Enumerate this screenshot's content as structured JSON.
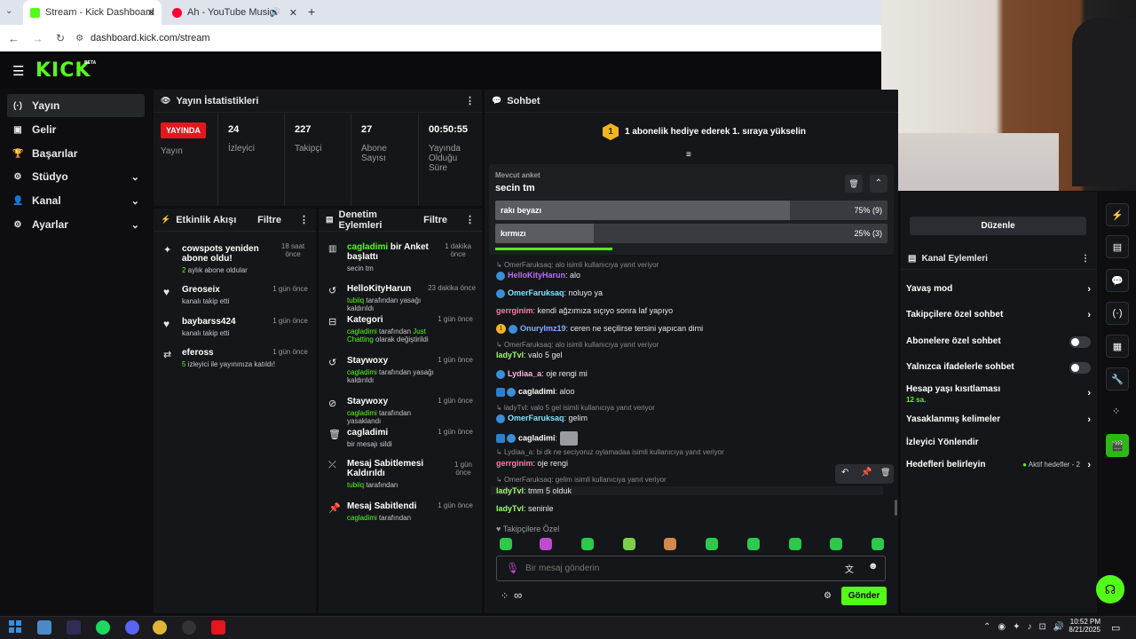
{
  "browser": {
    "tabs": [
      {
        "label": "Stream - Kick Dashboard",
        "active": true
      },
      {
        "label": "Ah - YouTube Music",
        "active": false
      }
    ],
    "new_tab": "+",
    "url": "dashboard.kick.com/stream"
  },
  "header": {
    "logo": "KICK",
    "logo_badge": "BETA"
  },
  "sidebar": {
    "items": [
      {
        "label": "Yayın",
        "icon": "broadcast-icon"
      },
      {
        "label": "Gelir",
        "icon": "dollar-icon"
      },
      {
        "label": "Başarılar",
        "icon": "trophy-icon"
      },
      {
        "label": "Stüdyo",
        "icon": "studio-icon"
      },
      {
        "label": "Kanal",
        "icon": "user-icon"
      },
      {
        "label": "Ayarlar",
        "icon": "gear-icon"
      }
    ]
  },
  "stats": {
    "title": "Yayın İstatistikleri",
    "live_badge": "YAYINDA",
    "live_label": "Yayın",
    "viewers_value": "24",
    "viewers_label": "İzleyici",
    "followers_value": "227",
    "followers_label": "Takipçi",
    "subs_value": "27",
    "subs_label": "Abone Sayısı",
    "uptime_value": "00:50:55",
    "uptime_label": "Yayında Olduğu Süre"
  },
  "activity": {
    "title": "Etkinlik Akışı",
    "filter": "Filtre",
    "items": [
      {
        "title": "cowspots yeniden abone oldu!",
        "sub_green": "2",
        "sub": " aylık abone oldular",
        "time": "18 saat önce"
      },
      {
        "title": "Greoseix",
        "sub_green": "",
        "sub": "kanalı takip etti",
        "time": "1 gün önce"
      },
      {
        "title": "baybarss424",
        "sub_green": "",
        "sub": "kanalı takip etti",
        "time": "1 gün önce"
      },
      {
        "title": "efeross",
        "sub_green": "5",
        "sub": " izleyici ile yayınınıza katıldı!",
        "time": "1 gün önce"
      }
    ]
  },
  "moderation": {
    "title": "Denetim Eylemleri",
    "filter": "Filtre",
    "items": [
      {
        "title_green": "cagladimi",
        "title": " bir Anket başlattı",
        "sub": "secin tm",
        "time": "1 dakika önce"
      },
      {
        "title": "HelloKityHarun",
        "sub_green": "tubiiq",
        "sub": " tarafından yasağı kaldırıldı",
        "time": "23 dakika önce"
      },
      {
        "title": "Kategori",
        "sub_green": "cagladimi",
        "sub": " tarafından ",
        "sub_green2": "Just Chatting",
        "sub2": " olarak değiştirildi",
        "time": "1 gün önce"
      },
      {
        "title": "Staywoxy",
        "sub_green": "cagladimi",
        "sub": " tarafından yasağı kaldırıldı",
        "time": "1 gün önce"
      },
      {
        "title": "Staywoxy",
        "sub_green": "cagladimi",
        "sub": " tarafından yasaklandı",
        "time": "1 gün önce"
      },
      {
        "title": "cagladimi",
        "sub_green": "",
        "sub": "bir mesajı sildi",
        "time": "1 gün önce"
      },
      {
        "title": "Mesaj Sabitlemesi Kaldırıldı",
        "sub_green": "tubiiq",
        "sub": " tarafından",
        "time": "1 gün önce"
      },
      {
        "title": "Mesaj Sabitlendi",
        "sub_green": "cagladimi",
        "sub": " tarafından",
        "time": "1 gün önce"
      }
    ]
  },
  "chat": {
    "title": "Sohbet",
    "gift_rank": "1",
    "gift_text": "1 abonelik hediye ederek 1. sıraya yükselin",
    "poll": {
      "label": "Mevcut anket",
      "question": "secin tm",
      "options": [
        {
          "text": "rakı beyazı",
          "result": "75% (9)",
          "percent": 75
        },
        {
          "text": "kırmızı",
          "result": "25% (3)",
          "percent": 25
        }
      ]
    },
    "messages": [
      {
        "reply": "OmerFaruksaq: alo isimli kullanıcıya yanıt veriyor"
      },
      {
        "user": "HelloKityHarun",
        "color": "#b86cff",
        "text": ": alo",
        "badge": "ver"
      },
      {
        "user": "OmerFaruksaq",
        "color": "#7de3ff",
        "text": ": noluyo ya",
        "badge": "ver"
      },
      {
        "user": "gerrginim",
        "color": "#ff7aa8",
        "text": ": kendi ağzımıza sıçıyo sonra laf yapıyo"
      },
      {
        "user": "Onurylmz19",
        "color": "#7db3ff",
        "text": ": ceren ne seçilirse tersini yapıcan dimi",
        "badge": "sub"
      },
      {
        "reply": "OmerFaruksaq: alo isimli kullanıcıya yanıt veriyor"
      },
      {
        "user": "ladyTvl",
        "color": "#9cff6a",
        "text": ": valo 5 gel"
      },
      {
        "user": "Lydiaa_a",
        "color": "#ffb0e0",
        "text": ": oje rengi mi",
        "badge": "ver"
      },
      {
        "user": "cagladimi",
        "color": "#ffffff",
        "text": ": aloo",
        "badge": "mod"
      },
      {
        "reply": "ladyTvl: valo 5 gel isimli kullanıcıya yanıt veriyor"
      },
      {
        "user": "OmerFaruksaq",
        "color": "#7de3ff",
        "text": ": gelim",
        "badge": "ver"
      },
      {
        "user": "cagladimi",
        "color": "#ffffff",
        "text": ":",
        "badge": "mod",
        "emote": true
      },
      {
        "reply": "Lydiaa_a: bi dk ne seciyoruz oylamadaa isimli kullanıcıya yanıt veriyor"
      },
      {
        "user": "gerrginim",
        "color": "#ff7aa8",
        "text": ": oje rengi"
      },
      {
        "reply": "OmerFaruksaq: gelim isimli kullanıcıya yanıt veriyor"
      },
      {
        "user": "ladyTvl",
        "color": "#9cff6a",
        "text": ": tmm 5 olduk"
      },
      {
        "user": "ladyTvl",
        "color": "#9cff6a",
        "text": ": seninle"
      }
    ],
    "followers_only": "Takipçilere Özel",
    "placeholder": "Bir mesaj gönderin",
    "send": "Gönder",
    "infinity": "∞"
  },
  "channel_actions": {
    "edit": "Düzenle",
    "title": "Kanal Eylemleri",
    "items": [
      {
        "label": "Yavaş mod",
        "kind": "arrow"
      },
      {
        "label": "Takipçilere özel sohbet",
        "kind": "arrow"
      },
      {
        "label": "Abonelere özel sohbet",
        "kind": "toggle"
      },
      {
        "label": "Yalnızca ifadelerle sohbet",
        "kind": "toggle"
      },
      {
        "label": "Hesap yaşı kısıtlaması",
        "sub": "12 sa.",
        "kind": "arrow"
      },
      {
        "label": "Yasaklanmış kelimeler",
        "kind": "arrow"
      },
      {
        "label": "İzleyici Yönlendir",
        "kind": "none"
      },
      {
        "label": "Hedefleri belirleyin",
        "kind": "arrow",
        "extra": "Aktif hedefler - 2"
      }
    ]
  },
  "taskbar": {
    "time": "10:52 PM",
    "date": "8/21/2025"
  },
  "colors": {
    "accent": "#53fc18",
    "live": "#e4161e"
  }
}
